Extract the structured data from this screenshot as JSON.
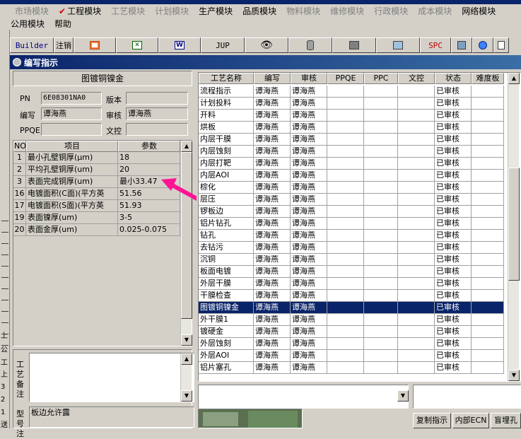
{
  "menu": {
    "row1": [
      {
        "label": "市场模块",
        "enabled": false
      },
      {
        "label": "工程模块",
        "enabled": true,
        "checked": true
      },
      {
        "label": "工艺模块",
        "enabled": false
      },
      {
        "label": "计划模块",
        "enabled": false
      },
      {
        "label": "生产模块",
        "enabled": true
      },
      {
        "label": "品质模块",
        "enabled": true
      },
      {
        "label": "物料模块",
        "enabled": false
      },
      {
        "label": "维修模块",
        "enabled": false
      },
      {
        "label": "行政模块",
        "enabled": false
      },
      {
        "label": "成本模块",
        "enabled": false
      },
      {
        "label": "网络模块",
        "enabled": true
      }
    ],
    "row2": [
      {
        "label": "公用模块"
      },
      {
        "label": "帮助"
      }
    ]
  },
  "toolbar": {
    "builder_label": "Builder",
    "logout_label": "注销",
    "jup_label": "JUP",
    "spc_label": "SPC"
  },
  "window": {
    "title": "编写指示"
  },
  "left_strip": [
    "上",
    "公",
    "工",
    "上",
    "3",
    "2",
    "1",
    "送"
  ],
  "form": {
    "header": "图镀铜镍金",
    "pn_label": "PN",
    "pn_value": "6E08301NA0",
    "version_label": "版本",
    "version_value": "",
    "author_label": "编写",
    "author_value": "谭海燕",
    "review_label": "审核",
    "review_value": "谭海燕",
    "ppqe_label": "PPQE",
    "ppqe_value": "",
    "doc_label": "文控",
    "doc_value": ""
  },
  "param_grid": {
    "headers": [
      "NO",
      "项目",
      "参数"
    ],
    "rows": [
      {
        "no": "1",
        "item": "最小孔壁铜厚(μm)",
        "value": "18"
      },
      {
        "no": "2",
        "item": "平均孔壁铜厚(um)",
        "value": "20"
      },
      {
        "no": "3",
        "item": "表面完成铜厚(um)",
        "value": "最小33.47"
      },
      {
        "no": "16",
        "item": "电镀面积(C面)(平方英",
        "value": "51.56"
      },
      {
        "no": "17",
        "item": "电镀面积(S面)(平方英",
        "value": "51.93"
      },
      {
        "no": "19",
        "item": "表面镍厚(um)",
        "value": "3-5"
      },
      {
        "no": "20",
        "item": "表面金厚(um)",
        "value": "0.025-0.075"
      }
    ]
  },
  "notes": {
    "process_note_label": "工艺备注",
    "process_note_value": "",
    "model_label": "型号注",
    "model_value": "板边允许露"
  },
  "process_grid": {
    "headers": [
      "工艺名称",
      "编写",
      "审核",
      "PPQE",
      "PPC",
      "文控",
      "状态",
      "难度板"
    ],
    "selected_index": 18,
    "rows": [
      {
        "name": "流程指示",
        "author": "谭海燕",
        "review": "谭海燕",
        "status": "已审核"
      },
      {
        "name": "计划投料",
        "author": "谭海燕",
        "review": "谭海燕",
        "status": "已审核"
      },
      {
        "name": "开料",
        "author": "谭海燕",
        "review": "谭海燕",
        "status": "已审核"
      },
      {
        "name": "烘板",
        "author": "谭海燕",
        "review": "谭海燕",
        "status": "已审核"
      },
      {
        "name": "内层干膜",
        "author": "谭海燕",
        "review": "谭海燕",
        "status": "已审核"
      },
      {
        "name": "内层蚀刻",
        "author": "谭海燕",
        "review": "谭海燕",
        "status": "已审核"
      },
      {
        "name": "内层打靶",
        "author": "谭海燕",
        "review": "谭海燕",
        "status": "已审核"
      },
      {
        "name": "内层AOI",
        "author": "谭海燕",
        "review": "谭海燕",
        "status": "已审核"
      },
      {
        "name": "棕化",
        "author": "谭海燕",
        "review": "谭海燕",
        "status": "已审核"
      },
      {
        "name": "层压",
        "author": "谭海燕",
        "review": "谭海燕",
        "status": "已审核"
      },
      {
        "name": "锣板边",
        "author": "谭海燕",
        "review": "谭海燕",
        "status": "已审核"
      },
      {
        "name": "铝片钻孔",
        "author": "谭海燕",
        "review": "谭海燕",
        "status": "已审核"
      },
      {
        "name": "钻孔",
        "author": "谭海燕",
        "review": "谭海燕",
        "status": "已审核"
      },
      {
        "name": "去钻污",
        "author": "谭海燕",
        "review": "谭海燕",
        "status": "已审核"
      },
      {
        "name": "沉铜",
        "author": "谭海燕",
        "review": "谭海燕",
        "status": "已审核"
      },
      {
        "name": "板面电镀",
        "author": "谭海燕",
        "review": "谭海燕",
        "status": "已审核"
      },
      {
        "name": "外层干膜",
        "author": "谭海燕",
        "review": "谭海燕",
        "status": "已审核"
      },
      {
        "name": "干膜检查",
        "author": "谭海燕",
        "review": "谭海燕",
        "status": "已审核"
      },
      {
        "name": "图镀铜镍金",
        "author": "谭海燕",
        "review": "谭海燕",
        "status": "已审核"
      },
      {
        "name": "外干膜1",
        "author": "谭海燕",
        "review": "谭海燕",
        "status": "已审核"
      },
      {
        "name": "镀硬金",
        "author": "谭海燕",
        "review": "谭海燕",
        "status": "已审核"
      },
      {
        "name": "外层蚀刻",
        "author": "谭海燕",
        "review": "谭海燕",
        "status": "已审核"
      },
      {
        "name": "外层AOI",
        "author": "谭海燕",
        "review": "谭海燕",
        "status": "已审核"
      },
      {
        "name": "铝片塞孔",
        "author": "谭海燕",
        "review": "谭海燕",
        "status": "已审核"
      }
    ]
  },
  "bottom_buttons": [
    "复制指示",
    "内部ECN",
    "盲埋孔"
  ],
  "colors": {
    "selection": "#0a246a",
    "arrow": "#ff1493",
    "title_bar": "#0a246a"
  }
}
